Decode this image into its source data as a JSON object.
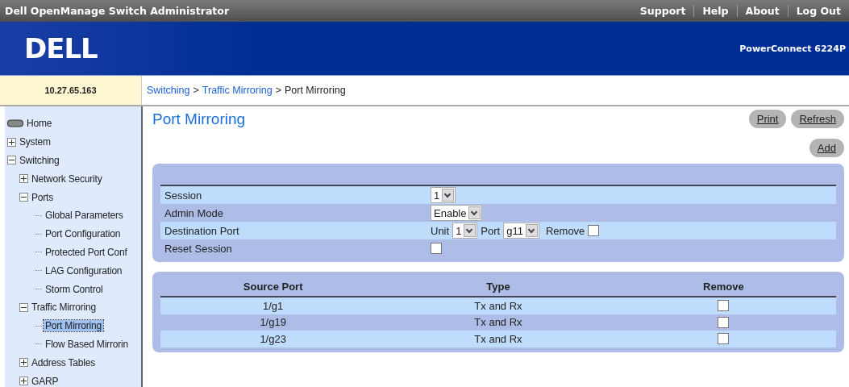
{
  "window": {
    "title": "Dell OpenManage Switch Administrator"
  },
  "top_links": [
    "Support",
    "Help",
    "About",
    "Log Out"
  ],
  "banner": {
    "logo": "DELL",
    "model": "PowerConnect 6224P"
  },
  "address": "10.27.65.163",
  "breadcrumb": {
    "separator": ">",
    "items": [
      "Switching",
      "Traffic Mirroring",
      "Port Mirroring"
    ]
  },
  "sidebar": {
    "items": [
      {
        "label": "Home",
        "kind": "root",
        "selected": false
      },
      {
        "label": "System",
        "kind": "node",
        "expanded": false,
        "selected": false
      },
      {
        "label": "Switching",
        "kind": "node",
        "expanded": true,
        "selected": false,
        "children": [
          {
            "label": "Network Security",
            "kind": "node",
            "expanded": false,
            "selected": false
          },
          {
            "label": "Ports",
            "kind": "node",
            "expanded": true,
            "selected": false,
            "children": [
              {
                "label": "Global Parameters",
                "kind": "leaf",
                "selected": false
              },
              {
                "label": "Port Configuration",
                "kind": "leaf",
                "selected": false
              },
              {
                "label": "Protected Port Conf",
                "kind": "leaf",
                "selected": false
              },
              {
                "label": "LAG Configuration",
                "kind": "leaf",
                "selected": false
              },
              {
                "label": "Storm Control",
                "kind": "leaf",
                "selected": false
              }
            ]
          },
          {
            "label": "Traffic Mirroring",
            "kind": "node",
            "expanded": true,
            "selected": false,
            "children": [
              {
                "label": "Port Mirroring",
                "kind": "leaf",
                "selected": true
              },
              {
                "label": "Flow Based Mirrorin",
                "kind": "leaf",
                "selected": false
              }
            ]
          },
          {
            "label": "Address Tables",
            "kind": "node",
            "expanded": false,
            "selected": false
          },
          {
            "label": "GARP",
            "kind": "node",
            "expanded": false,
            "selected": false
          }
        ]
      }
    ]
  },
  "page_title": "Port Mirroring",
  "buttons": [
    "Print",
    "Refresh"
  ],
  "add_button": "Add",
  "form": {
    "rows": [
      {
        "kind": "select",
        "label": "Session",
        "value": "1"
      },
      {
        "kind": "select",
        "label": "Admin Mode",
        "value": "Enable"
      },
      {
        "kind": "destination",
        "label": "Destination Port",
        "unit_label": "Unit",
        "unit": "1",
        "port_label": "Port",
        "port": "g11",
        "remove_label": "Remove",
        "remove_checked": false
      },
      {
        "kind": "checkbox",
        "label": "Reset Session",
        "checked": false
      }
    ]
  },
  "table": {
    "columns": [
      "Source Port",
      "Type",
      "Remove"
    ],
    "rows": [
      {
        "source": "1/g1",
        "type": "Tx and Rx",
        "remove": false
      },
      {
        "source": "1/g19",
        "type": "Tx and Rx",
        "remove": false
      },
      {
        "source": "1/g23",
        "type": "Tx and Rx",
        "remove": false
      }
    ]
  }
}
